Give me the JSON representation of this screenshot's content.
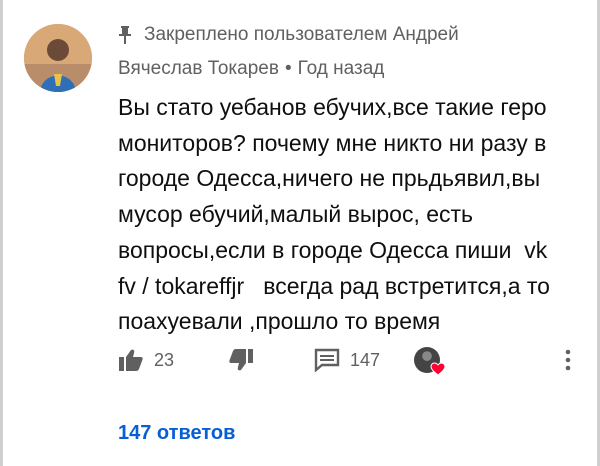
{
  "comment": {
    "pinned_label": "Закреплено пользователем Андрей",
    "author": "Вячеслав Токарев",
    "separator": "•",
    "time": "Год назад",
    "text": "Вы стато уебанов ебучих,все такие геро\nмониторов? почему мне никто ни разу в\nгороде Одесса,ничего не прьдьявил,вы\nмусор ебучий,малый вырос, есть\nвопросы,если в городе Одесса пиши  vk\nfv / tokareffjr   всегда рад встретится,а то\nпоахуевали ,прошло то время",
    "likes": "23",
    "reply_count": "147",
    "replies_label": "147 ответов"
  },
  "icons": {
    "pin": "pin-icon",
    "like": "thumb-up-icon",
    "dislike": "thumb-down-icon",
    "reply": "comment-icon",
    "heart": "heart-icon",
    "more": "more-vert-icon"
  },
  "colors": {
    "link": "#065fd4",
    "heart": "#ff0033",
    "meta": "#606060"
  }
}
